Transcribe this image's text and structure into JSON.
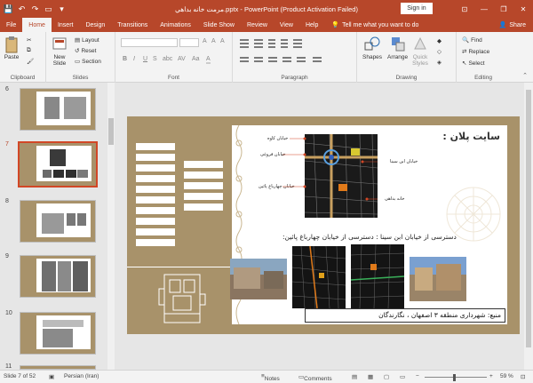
{
  "window": {
    "title": "مرمت خانه بداهي.pptx - PowerPoint (Product Activation Failed)",
    "signin": "Sign in",
    "controls": {
      "minimize": "—",
      "restore": "❐",
      "close": "✕"
    }
  },
  "tabs": [
    "File",
    "Home",
    "Insert",
    "Design",
    "Transitions",
    "Animations",
    "Slide Show",
    "Review",
    "View",
    "Help"
  ],
  "active_tab": "Home",
  "tellme": "Tell me what you want to do",
  "share": "Share",
  "ribbon": {
    "clipboard": {
      "paste": "Paste",
      "label": "Clipboard"
    },
    "slides": {
      "new_slide_1": "New",
      "new_slide_2": "Slide",
      "layout": "Layout",
      "reset": "Reset",
      "section": "Section",
      "label": "Slides"
    },
    "font": {
      "bold": "B",
      "italic": "I",
      "underline": "U",
      "strike": "S",
      "spacing": "abc",
      "shadow": "AV",
      "case": "Aa",
      "color": "A",
      "label": "Font"
    },
    "paragraph": {
      "label": "Paragraph"
    },
    "drawing": {
      "shapes": "Shapes",
      "arrange": "Arrange",
      "quick_1": "Quick",
      "quick_2": "Styles",
      "label": "Drawing"
    },
    "editing": {
      "find": "Find",
      "replace": "Replace",
      "select": "Select",
      "label": "Editing"
    }
  },
  "thumbnails": [
    {
      "num": "6",
      "selected": false
    },
    {
      "num": "7",
      "selected": true
    },
    {
      "num": "8",
      "selected": false
    },
    {
      "num": "9",
      "selected": false
    },
    {
      "num": "10",
      "selected": false
    },
    {
      "num": "11",
      "selected": false
    }
  ],
  "slide": {
    "title": "سایت پلان :",
    "labels": {
      "koh": "خیابان کاوه",
      "farokhi": "خیابان فروغی",
      "chaharbagh": "خیابان چهارباغ پائین",
      "ibnsina": "خیابان ابن سینا",
      "house": "خانه بداهی"
    },
    "access_text": "دسترسی از خیابان ابن سینا :",
    "access_text2": "دسترسی از خیابان چهارباغ پائین:",
    "source_text": "منبع: شهرداری منطقه ۳ اصفهان ، نگارندگان"
  },
  "status": {
    "slide": "Slide 7 of 52",
    "language": "Persian (Iran)",
    "notes": "Notes",
    "comments": "Comments",
    "zoom": "59 %"
  },
  "colors": {
    "accent": "#b7472a",
    "slide_bg": "#a8926a",
    "selection": "#d24726"
  }
}
